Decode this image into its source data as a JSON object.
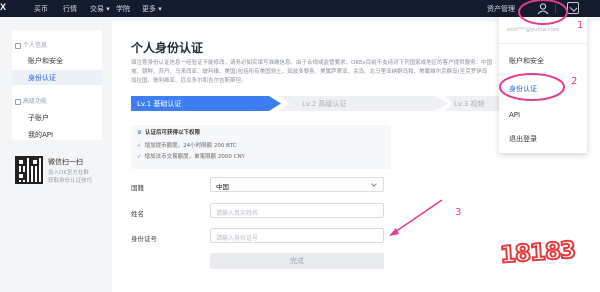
{
  "nav": {
    "logo": "X",
    "items": [
      "买币",
      "行情",
      "交易 ▾",
      "学院",
      "更多 ▾"
    ],
    "asset_management": "资产管理"
  },
  "sidebar": {
    "group1_title": "个人信息",
    "items1": [
      "账户和安全",
      "身份认证"
    ],
    "group2_title": "高级功能",
    "items2": [
      "子账户",
      "我的API"
    ],
    "wechat_title": "微信扫一扫",
    "wechat_desc": [
      "加入OK官方社群",
      "获取身份认证技巧"
    ]
  },
  "main": {
    "title": "个人身份认证",
    "notice": [
      "填注意身份认证信息一经验证不能修改，请务必如实填写准确信息。由于合规或监管要求，OKEx目前不支持对下列国家或地区的客户提供服务：中国",
      "坡、朝鲜、苏丹、马来西亚、玻利维、美国(包括所有美国领土，如波多黎各、美属萨摩亚、关岛、北马里亚纳群岛和、美属维尔京群岛(圣克罗伊岛",
      "加拉国、玻利维亚、厄瓜多尔和吉尔吉斯斯坦。"
    ],
    "steps": [
      "Lv.1 基础认证",
      "Lv.2 高级认证",
      "Lv.3 视频"
    ],
    "perm_title": "认证后可获得以下权限",
    "perm_items": [
      "增加提币额度，24小时限额 200 BTC",
      "增加法币交易额度，单笔限额 2000 CNY"
    ],
    "form": {
      "country_label": "国籍",
      "country_value": "中国",
      "name_label": "姓名",
      "name_placeholder": "请输入真实姓名",
      "id_label": "身份证号",
      "id_placeholder": "请输入身份证号",
      "submit": "完成"
    }
  },
  "dropdown": {
    "email": "ooo***@yuhia.com",
    "items": [
      "账户和安全",
      "身份认证",
      "API",
      "退出登录"
    ]
  },
  "annotations": [
    "1",
    "2",
    "3"
  ],
  "watermark": "18183",
  "colors": {
    "nav_bg": "#141b2e",
    "primary": "#3d7ef2",
    "annotation": "#e23c8f"
  }
}
